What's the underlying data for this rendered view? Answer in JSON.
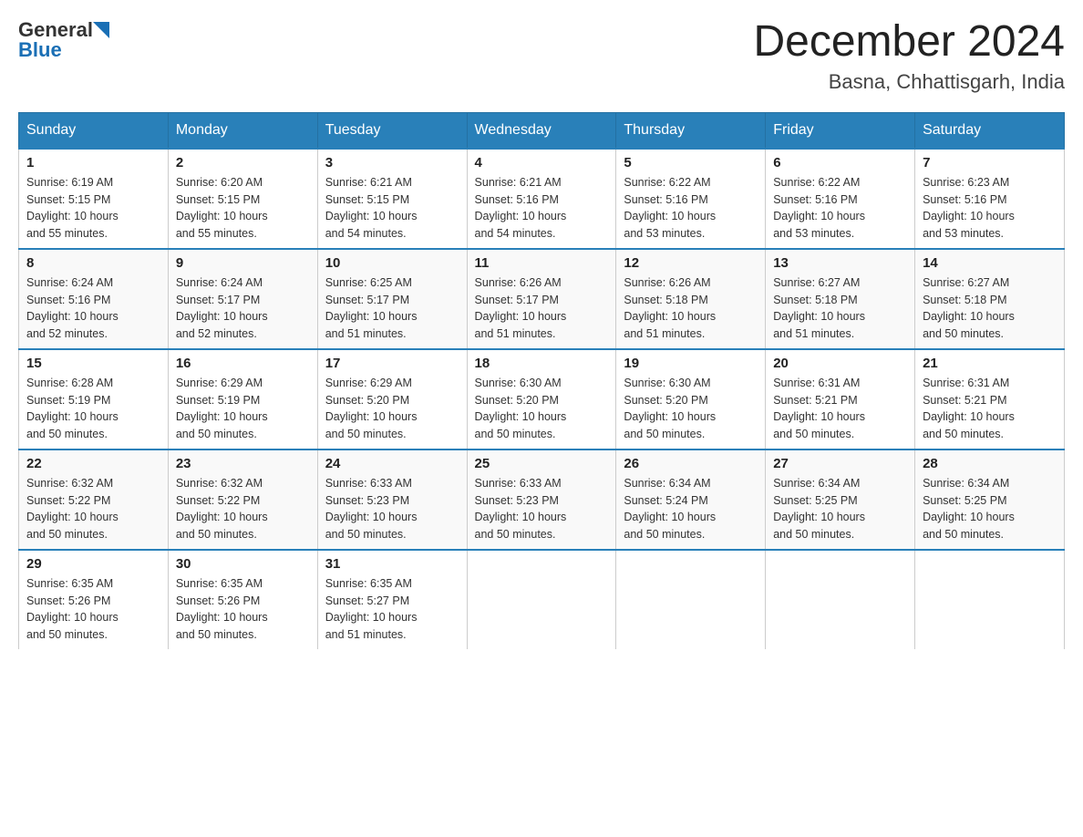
{
  "header": {
    "logo": {
      "general": "General",
      "blue": "Blue"
    },
    "title": "December 2024",
    "location": "Basna, Chhattisgarh, India"
  },
  "calendar": {
    "days_of_week": [
      "Sunday",
      "Monday",
      "Tuesday",
      "Wednesday",
      "Thursday",
      "Friday",
      "Saturday"
    ],
    "weeks": [
      [
        {
          "day": "1",
          "sunrise": "6:19 AM",
          "sunset": "5:15 PM",
          "daylight": "10 hours and 55 minutes."
        },
        {
          "day": "2",
          "sunrise": "6:20 AM",
          "sunset": "5:15 PM",
          "daylight": "10 hours and 55 minutes."
        },
        {
          "day": "3",
          "sunrise": "6:21 AM",
          "sunset": "5:15 PM",
          "daylight": "10 hours and 54 minutes."
        },
        {
          "day": "4",
          "sunrise": "6:21 AM",
          "sunset": "5:16 PM",
          "daylight": "10 hours and 54 minutes."
        },
        {
          "day": "5",
          "sunrise": "6:22 AM",
          "sunset": "5:16 PM",
          "daylight": "10 hours and 53 minutes."
        },
        {
          "day": "6",
          "sunrise": "6:22 AM",
          "sunset": "5:16 PM",
          "daylight": "10 hours and 53 minutes."
        },
        {
          "day": "7",
          "sunrise": "6:23 AM",
          "sunset": "5:16 PM",
          "daylight": "10 hours and 53 minutes."
        }
      ],
      [
        {
          "day": "8",
          "sunrise": "6:24 AM",
          "sunset": "5:16 PM",
          "daylight": "10 hours and 52 minutes."
        },
        {
          "day": "9",
          "sunrise": "6:24 AM",
          "sunset": "5:17 PM",
          "daylight": "10 hours and 52 minutes."
        },
        {
          "day": "10",
          "sunrise": "6:25 AM",
          "sunset": "5:17 PM",
          "daylight": "10 hours and 51 minutes."
        },
        {
          "day": "11",
          "sunrise": "6:26 AM",
          "sunset": "5:17 PM",
          "daylight": "10 hours and 51 minutes."
        },
        {
          "day": "12",
          "sunrise": "6:26 AM",
          "sunset": "5:18 PM",
          "daylight": "10 hours and 51 minutes."
        },
        {
          "day": "13",
          "sunrise": "6:27 AM",
          "sunset": "5:18 PM",
          "daylight": "10 hours and 51 minutes."
        },
        {
          "day": "14",
          "sunrise": "6:27 AM",
          "sunset": "5:18 PM",
          "daylight": "10 hours and 50 minutes."
        }
      ],
      [
        {
          "day": "15",
          "sunrise": "6:28 AM",
          "sunset": "5:19 PM",
          "daylight": "10 hours and 50 minutes."
        },
        {
          "day": "16",
          "sunrise": "6:29 AM",
          "sunset": "5:19 PM",
          "daylight": "10 hours and 50 minutes."
        },
        {
          "day": "17",
          "sunrise": "6:29 AM",
          "sunset": "5:20 PM",
          "daylight": "10 hours and 50 minutes."
        },
        {
          "day": "18",
          "sunrise": "6:30 AM",
          "sunset": "5:20 PM",
          "daylight": "10 hours and 50 minutes."
        },
        {
          "day": "19",
          "sunrise": "6:30 AM",
          "sunset": "5:20 PM",
          "daylight": "10 hours and 50 minutes."
        },
        {
          "day": "20",
          "sunrise": "6:31 AM",
          "sunset": "5:21 PM",
          "daylight": "10 hours and 50 minutes."
        },
        {
          "day": "21",
          "sunrise": "6:31 AM",
          "sunset": "5:21 PM",
          "daylight": "10 hours and 50 minutes."
        }
      ],
      [
        {
          "day": "22",
          "sunrise": "6:32 AM",
          "sunset": "5:22 PM",
          "daylight": "10 hours and 50 minutes."
        },
        {
          "day": "23",
          "sunrise": "6:32 AM",
          "sunset": "5:22 PM",
          "daylight": "10 hours and 50 minutes."
        },
        {
          "day": "24",
          "sunrise": "6:33 AM",
          "sunset": "5:23 PM",
          "daylight": "10 hours and 50 minutes."
        },
        {
          "day": "25",
          "sunrise": "6:33 AM",
          "sunset": "5:23 PM",
          "daylight": "10 hours and 50 minutes."
        },
        {
          "day": "26",
          "sunrise": "6:34 AM",
          "sunset": "5:24 PM",
          "daylight": "10 hours and 50 minutes."
        },
        {
          "day": "27",
          "sunrise": "6:34 AM",
          "sunset": "5:25 PM",
          "daylight": "10 hours and 50 minutes."
        },
        {
          "day": "28",
          "sunrise": "6:34 AM",
          "sunset": "5:25 PM",
          "daylight": "10 hours and 50 minutes."
        }
      ],
      [
        {
          "day": "29",
          "sunrise": "6:35 AM",
          "sunset": "5:26 PM",
          "daylight": "10 hours and 50 minutes."
        },
        {
          "day": "30",
          "sunrise": "6:35 AM",
          "sunset": "5:26 PM",
          "daylight": "10 hours and 50 minutes."
        },
        {
          "day": "31",
          "sunrise": "6:35 AM",
          "sunset": "5:27 PM",
          "daylight": "10 hours and 51 minutes."
        },
        null,
        null,
        null,
        null
      ]
    ],
    "labels": {
      "sunrise": "Sunrise:",
      "sunset": "Sunset:",
      "daylight": "Daylight:"
    }
  }
}
